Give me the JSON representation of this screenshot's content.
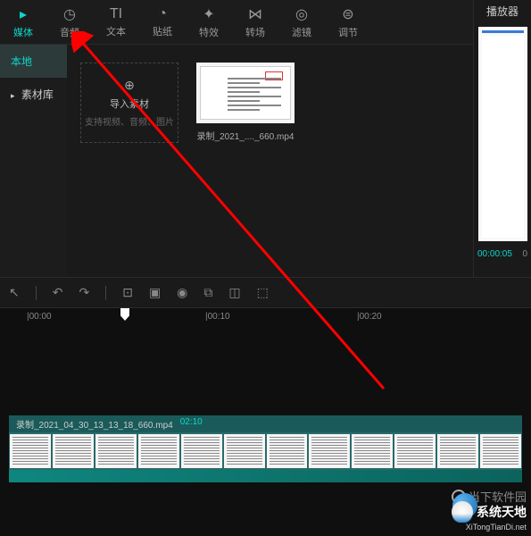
{
  "topTabs": [
    {
      "label": "媒体",
      "icon": "▸"
    },
    {
      "label": "音频",
      "icon": "◷"
    },
    {
      "label": "文本",
      "icon": "TI"
    },
    {
      "label": "贴纸",
      "icon": "◔"
    },
    {
      "label": "特效",
      "icon": "✦"
    },
    {
      "label": "转场",
      "icon": "⋈"
    },
    {
      "label": "滤镜",
      "icon": "◎"
    },
    {
      "label": "调节",
      "icon": "⊜"
    }
  ],
  "sidebar": {
    "items": [
      {
        "label": "本地",
        "active": true
      },
      {
        "label": "素材库",
        "active": false
      }
    ]
  },
  "importBox": {
    "plus": "⊕",
    "title": "导入素材",
    "subtitle": "支持视频、音频、图片"
  },
  "mediaItem": {
    "filename": "录制_2021_...._660.mp4"
  },
  "preview": {
    "title": "播放器",
    "currentTime": "00:00:05",
    "totalTime": "0"
  },
  "toolbar": {
    "tools": [
      "↖",
      "↶",
      "↷",
      "⊡",
      "▣",
      "◉",
      "⧉",
      "◫",
      "⬚"
    ]
  },
  "ruler": {
    "marks": [
      "|00:00",
      "|00:10",
      "|00:20"
    ]
  },
  "track": {
    "filename": "录制_2021_04_30_13_13_18_660.mp4",
    "duration": "02:10"
  },
  "watermark": {
    "topText": "当下软件园",
    "name": "系统天地",
    "url": "XiTongTianDi.net"
  }
}
